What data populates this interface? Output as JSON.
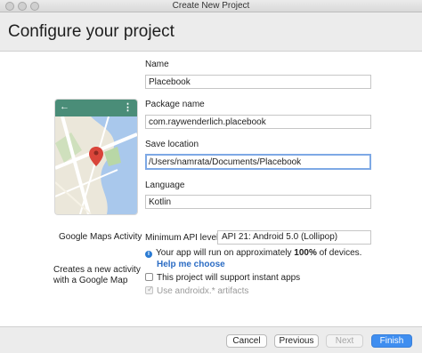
{
  "window": {
    "title": "Create New Project"
  },
  "header": {
    "title": "Configure your project"
  },
  "template": {
    "name": "Google Maps Activity",
    "description": "Creates a new activity with a Google Map"
  },
  "form": {
    "name_label": "Name",
    "name_value": "Placebook",
    "package_label": "Package name",
    "package_value": "com.raywenderlich.placebook",
    "save_label": "Save location",
    "save_value": "/Users/namrata/Documents/Placebook",
    "language_label": "Language",
    "language_value": "Kotlin",
    "min_api_label": "Minimum API level",
    "min_api_value": "API 21: Android 5.0 (Lollipop)",
    "api_info_prefix": "Your app will run on approximately ",
    "api_info_percent": "100%",
    "api_info_suffix": " of devices.",
    "help_link": "Help me choose",
    "instant_apps_label": "This project will support instant apps",
    "instant_apps_checked": false,
    "androidx_label": "Use androidx.* artifacts",
    "androidx_checked": true
  },
  "footer": {
    "cancel_label": "Cancel",
    "previous_label": "Previous",
    "next_label": "Next",
    "finish_label": "Finish"
  },
  "colors": {
    "accent": "#3f8ef0",
    "link": "#2b6cc4",
    "phone_toolbar": "#4a8d78",
    "focus_ring": "#7ea9e5"
  },
  "icons": {
    "phone_back": "arrow-left-icon",
    "phone_menu": "more-vert-icon",
    "map_marker": "map-pin-icon",
    "info": "info-bulb-icon"
  }
}
